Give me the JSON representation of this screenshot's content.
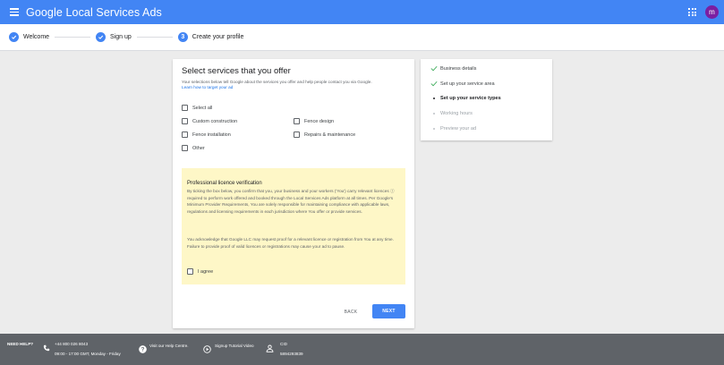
{
  "appbar": {
    "title": "Google Local Services Ads",
    "avatar_letter": "m"
  },
  "stepper": {
    "steps": [
      {
        "label": "Welcome",
        "state": "done"
      },
      {
        "label": "Sign up",
        "state": "done"
      },
      {
        "label": "Create your profile",
        "state": "current",
        "number": "3"
      }
    ]
  },
  "card": {
    "title": "Select services that you offer",
    "description": "Your selections below tell Google about the services you offer and help people contact you via Google.",
    "link": "Learn how to target your ad",
    "checkboxes": {
      "select_all": "Select all",
      "custom_construction": "Custom construction",
      "fence_design": "Fence design",
      "fence_installation": "Fence installation",
      "repairs_maintenance": "Repairs & maintenance",
      "other": "Other"
    },
    "licence": {
      "title": "Professional licence verification",
      "para1": "By ticking the box below, you confirm that you, your business and your workers ('You') carry relevant licences ⓘ required to perform work offered and booked through the Local Services Ads platform at all times. Per Google's Minimum Provider Requirements, You are solely responsible for maintaining compliance with applicable laws, regulations and licensing requirements in each jurisdiction where You offer or provide services.",
      "para2": "You acknowledge that Google LLC may request proof for a relevant licence or registration from You at any time. Failure to provide proof of valid licences or registrations may cause your ad to pause.",
      "agree_label": "I agree"
    },
    "back_label": "BACK",
    "next_label": "NEXT"
  },
  "progress": {
    "items": [
      {
        "label": "Business details",
        "state": "done"
      },
      {
        "label": "Set up your service area",
        "state": "done"
      },
      {
        "label": "Set up your service types",
        "state": "current"
      },
      {
        "label": "Working hours",
        "state": "todo"
      },
      {
        "label": "Preview your ad",
        "state": "todo"
      }
    ]
  },
  "footer": {
    "need_help": "NEED HELP?",
    "phone": "+44 800 026 8043",
    "hours": "09:00 - 17:00 GMT, Monday - Friday",
    "help_centre": "Visit our Help Centre.",
    "tutorial": "Signup Tutorial Video",
    "cid_label": "CID",
    "cid_value": "5894293839"
  },
  "colors": {
    "brand_blue": "#4285f4",
    "success_green": "#34a853",
    "avatar_purple": "#7b1fa2",
    "licence_bg": "#fef7c7"
  }
}
